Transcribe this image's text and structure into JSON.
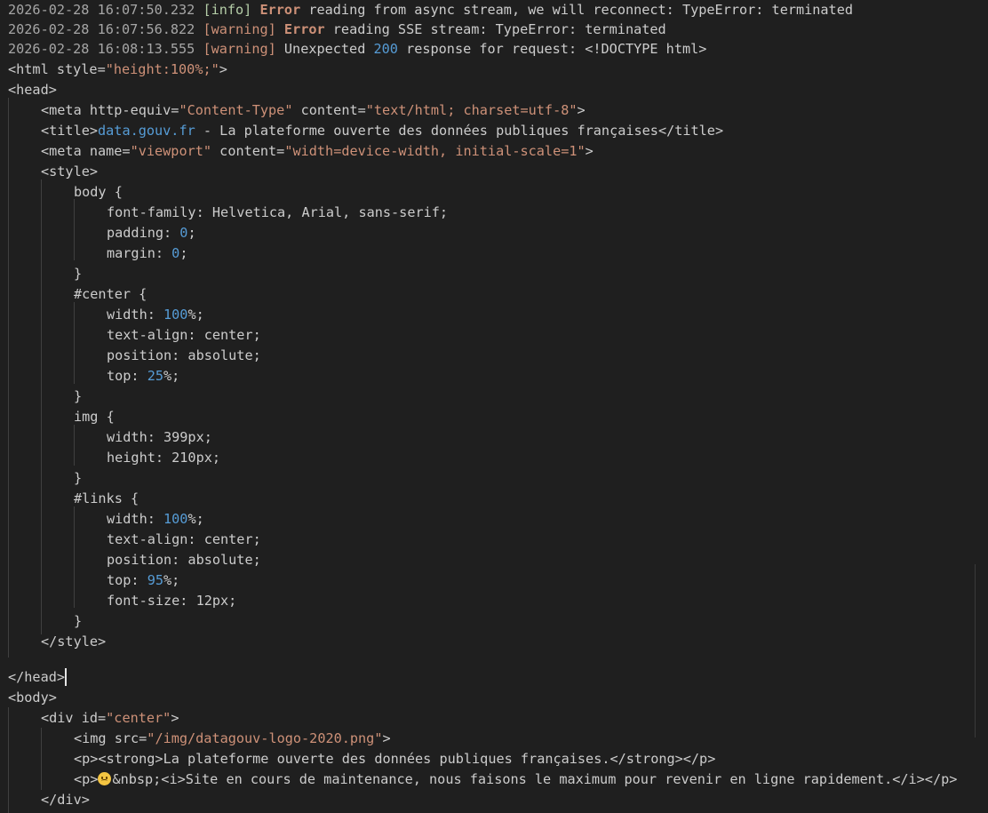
{
  "log": [
    {
      "timestamp": "2026-02-28 16:07:50.232",
      "level": "[info]",
      "error_word": "Error",
      "message": " reading from async stream, we will reconnect: TypeError: terminated"
    },
    {
      "timestamp": "2026-02-28 16:07:56.822",
      "level": "[warning]",
      "error_word": "Error",
      "message": " reading SSE stream: TypeError: terminated"
    },
    {
      "timestamp": "2026-02-28 16:08:13.555",
      "level": "[warning]",
      "message_a": " Unexpected ",
      "status_code": "200",
      "message_b": " response for request: <!DOCTYPE html>"
    }
  ],
  "html_lines": {
    "l3_a": "<html style=",
    "l3_b": "\"height:100%;\"",
    "l3_c": ">",
    "l4": "<head>",
    "l5_a": "<meta http-equiv=",
    "l5_b": "\"Content-Type\"",
    "l5_c": " content=",
    "l5_d": "\"text/html; charset=utf-8\"",
    "l5_e": ">",
    "l6_a": "<title>",
    "l6_b": "data.gouv.fr",
    "l6_c": " - La plateforme ouverte des données publiques françaises</title>",
    "l7_a": "<meta name=",
    "l7_b": "\"viewport\"",
    "l7_c": " content=",
    "l7_d": "\"width=device-width, initial-scale=1\"",
    "l7_e": ">",
    "l8": "<style>",
    "l9": "body {",
    "l10": "font-family: Helvetica, Arial, sans-serif;",
    "l11_a": "padding: ",
    "l11_b": "0",
    "l11_c": ";",
    "l12_a": "margin: ",
    "l12_b": "0",
    "l12_c": ";",
    "l13": "}",
    "l14": "#center {",
    "l15_a": "width: ",
    "l15_b": "100",
    "l15_c": "%;",
    "l16": "text-align: center;",
    "l17": "position: absolute;",
    "l18_a": "top: ",
    "l18_b": "25",
    "l18_c": "%;",
    "l19": "}",
    "l20": "img {",
    "l21": "width: 399px;",
    "l22": "height: 210px;",
    "l23": "}",
    "l24": "#links {",
    "l25_a": "width: ",
    "l25_b": "100",
    "l25_c": "%;",
    "l26": "text-align: center;",
    "l27": "position: absolute;",
    "l28_a": "top: ",
    "l28_b": "95",
    "l28_c": "%;",
    "l29": "font-size: 12px;",
    "l30": "}",
    "l31": "</style>",
    "l33": "</head>",
    "l34": "<body>",
    "l35_a": "<div id=",
    "l35_b": "\"center\"",
    "l35_c": ">",
    "l36_a": "<img src=",
    "l36_b": "\"/img/datagouv-logo-2020.png\"",
    "l36_c": ">",
    "l37": "<p><strong>La plateforme ouverte des données publiques françaises.</strong></p>",
    "l38_a": "<p>",
    "l38_b": "&nbsp;<i>Site en cours de maintenance, nous faisons le maximum pour revenir en ligne rapidement.</i></p>",
    "l39": "</div>"
  },
  "colors": {
    "background": "#1f1f1f",
    "text": "#cccccc",
    "timestamp": "#a6a6a6",
    "string": "#ce9178",
    "number": "#569cd6",
    "info_level": "#b5cea8"
  }
}
